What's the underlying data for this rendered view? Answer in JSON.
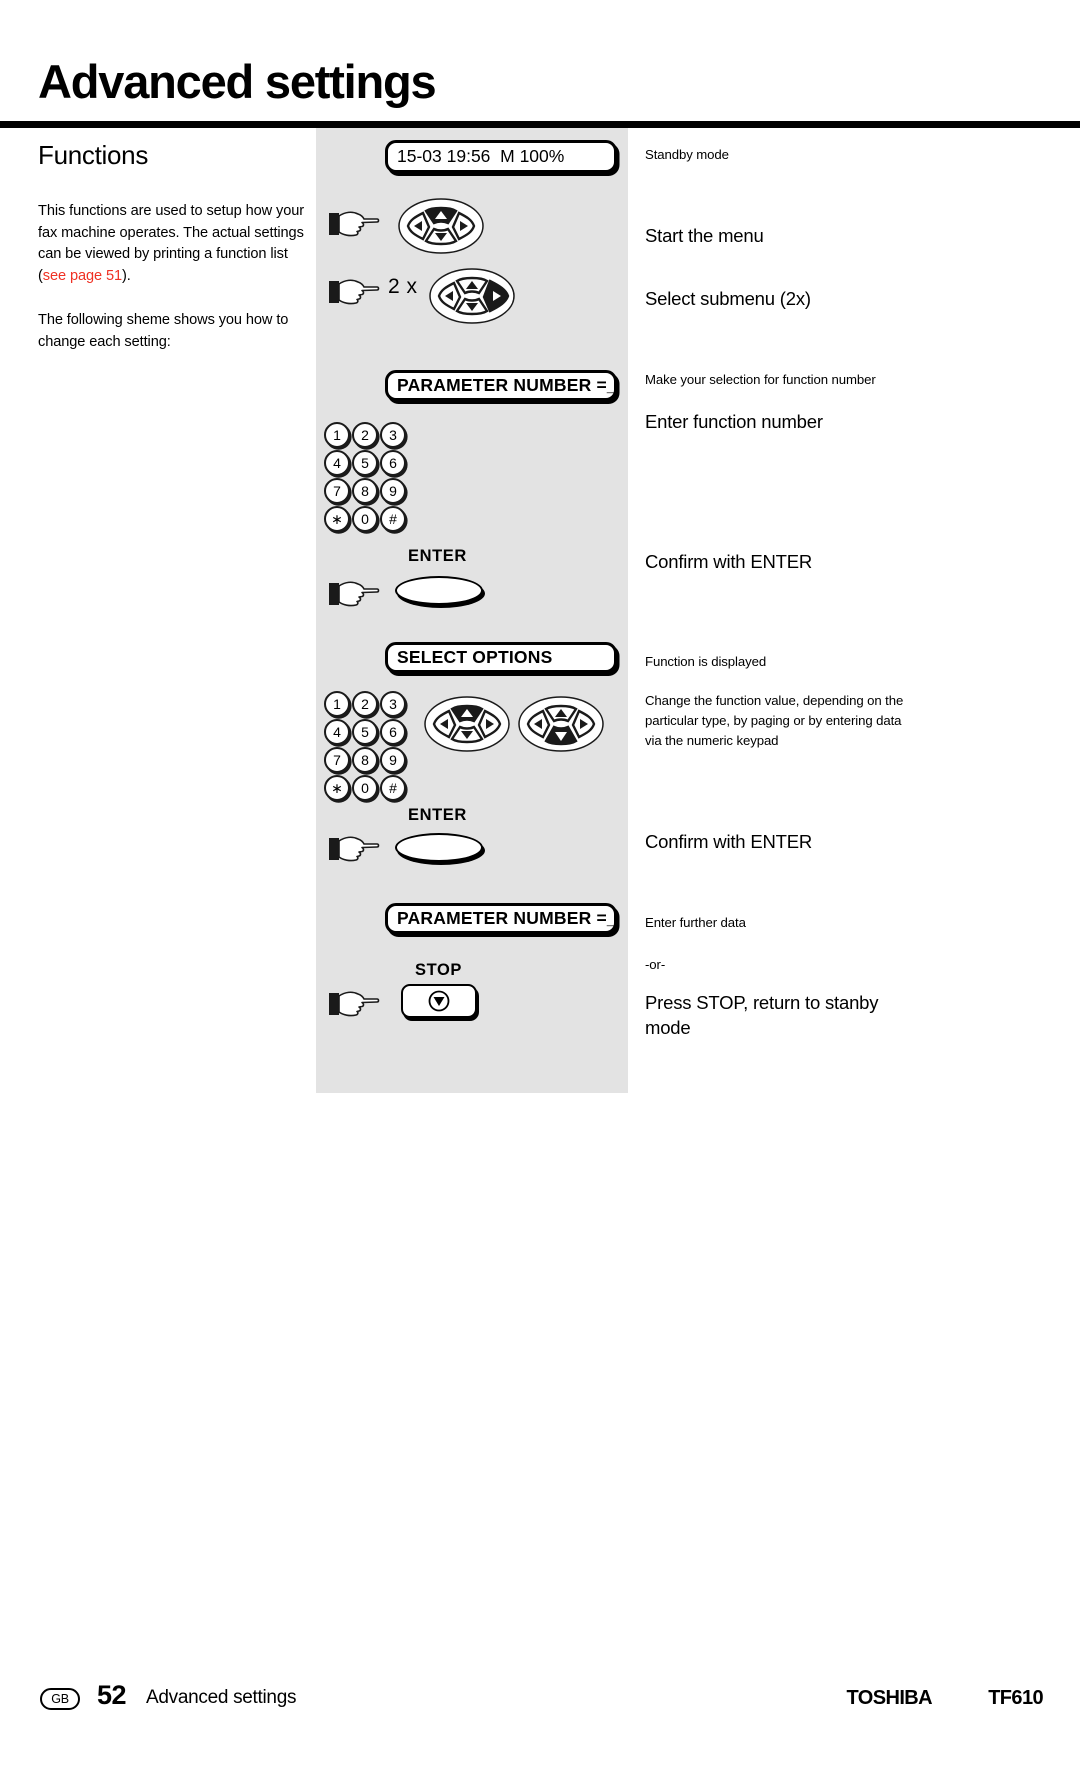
{
  "header": {
    "title": "Advanced settings"
  },
  "left": {
    "section_title": "Functions",
    "para1_a": "This functions are used to setup how your fax machine operates. The actual settings can be viewed by printing a function list (",
    "para1_link": "see page 51",
    "para1_b": ").",
    "para2": "The following sheme shows you how to change each setting:"
  },
  "diagram": {
    "lcd_standby": "15-03 19:56  M 100%",
    "lcd_parameter_1": "PARAMETER NUMBER =_",
    "lcd_select_options": "SELECT OPTIONS",
    "lcd_parameter_2": "PARAMETER NUMBER =_",
    "enter_label_1": "ENTER",
    "enter_label_2": "ENTER",
    "stop_label": "STOP",
    "repeat_label": "2 x",
    "keypad_rows": [
      [
        "1",
        "2",
        "3"
      ],
      [
        "4",
        "5",
        "6"
      ],
      [
        "7",
        "8",
        "9"
      ],
      [
        "∗",
        "0",
        "#"
      ]
    ],
    "navpads": [
      {
        "name": "navpad-up-highlighted",
        "highlight": "up"
      },
      {
        "name": "navpad-right-highlighted",
        "highlight": "right"
      },
      {
        "name": "navpad-up-highlighted-2",
        "highlight": "up"
      },
      {
        "name": "navpad-down-highlighted",
        "highlight": "down"
      }
    ]
  },
  "right": {
    "step1_note": "Standby mode",
    "step2_action": "Start the menu",
    "step3_action": "Select submenu (2x)",
    "step4_note": "Make your selection for function number",
    "step4_action": "Enter function number",
    "step5_action": "Confirm with ENTER",
    "step6_note": "Function is displayed",
    "step7_note": "Change the function value, depending on the particular type, by paging or by entering data via the numeric keypad",
    "step8_action": "Confirm with ENTER",
    "step9_note": "Enter further data",
    "step9_or": "-or-",
    "step10_action": "Press STOP, return to stanby mode"
  },
  "footer": {
    "language_badge": "GB",
    "page_number": "52",
    "section": "Advanced settings",
    "brand": "TOSHIBA",
    "model": "TF610"
  },
  "colors": {
    "panel_bg": "#e3e3e3",
    "link_red": "#ef3124",
    "ink": "#000000"
  }
}
